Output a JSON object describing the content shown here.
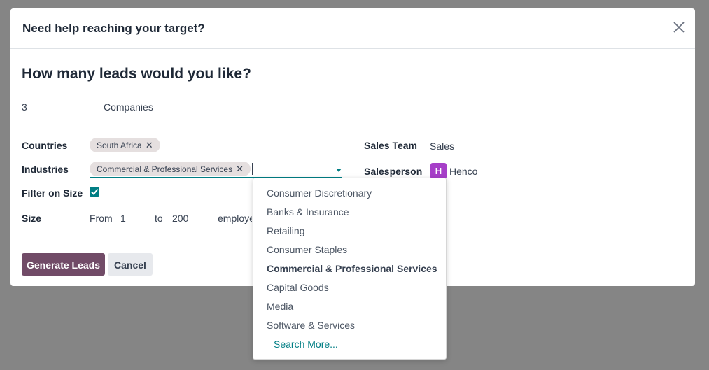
{
  "dialog": {
    "title": "Need help reaching your target?",
    "question": "How many leads would you like?"
  },
  "lead_count": "3",
  "lead_type": "Companies",
  "countries": {
    "label": "Countries",
    "tags": [
      "South Africa"
    ]
  },
  "industries": {
    "label": "Industries",
    "tags": [
      "Commercial & Professional Services"
    ]
  },
  "filter_on_size": {
    "label": "Filter on Size",
    "checked": true
  },
  "size": {
    "label": "Size",
    "from_label": "From",
    "from_value": "1",
    "to_label": "to",
    "to_value": "200",
    "unit": "employe"
  },
  "sales_team": {
    "label": "Sales Team",
    "value": "Sales"
  },
  "salesperson": {
    "label": "Salesperson",
    "avatar_letter": "H",
    "value": "Henco"
  },
  "buttons": {
    "generate": "Generate Leads",
    "cancel": "Cancel"
  },
  "industry_dropdown": {
    "items": [
      "Consumer Discretionary",
      "Banks & Insurance",
      "Retailing",
      "Consumer Staples",
      "Commercial & Professional Services",
      "Capital Goods",
      "Media",
      "Software & Services"
    ],
    "highlighted_index": 4,
    "search_more": "Search More..."
  },
  "colors": {
    "primary": "#714b67",
    "accent": "#017e84",
    "avatar": "#a63fc8",
    "tag_bg": "#e5dfdf",
    "backdrop": "#858585"
  }
}
